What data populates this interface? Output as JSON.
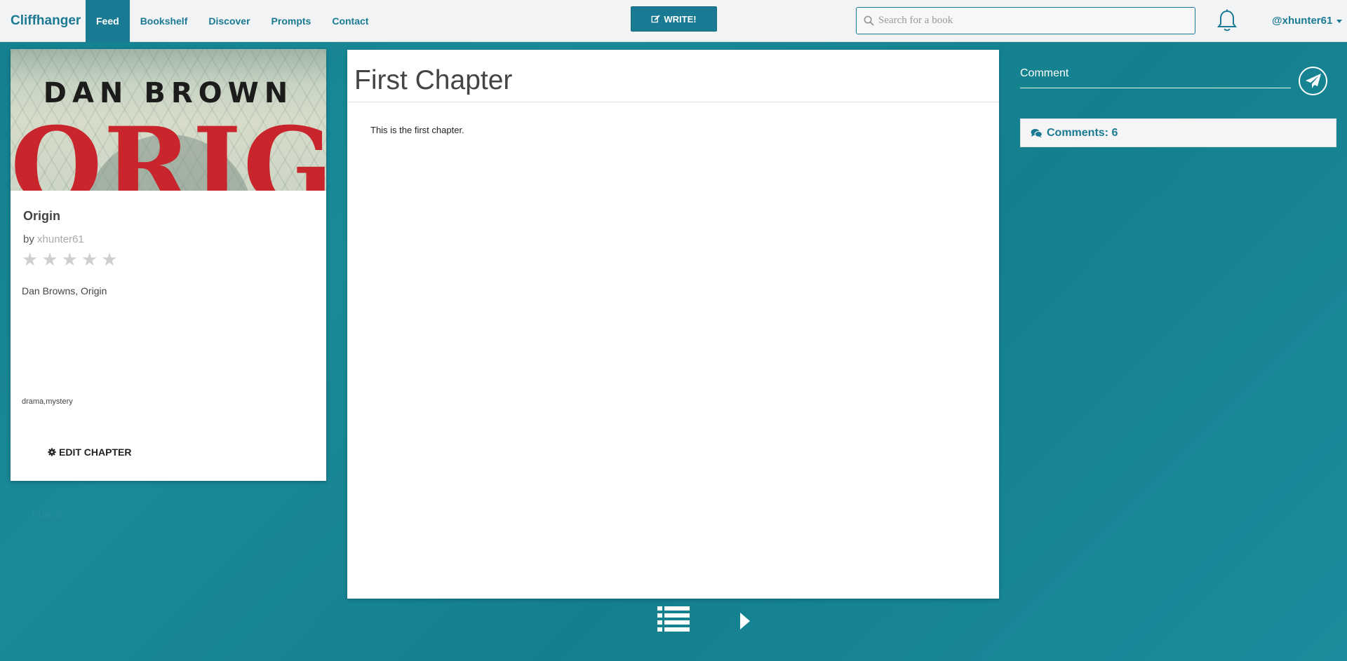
{
  "navbar": {
    "brand": "Cliffhanger",
    "items": [
      {
        "label": "Feed",
        "active": true
      },
      {
        "label": "Bookshelf",
        "active": false
      },
      {
        "label": "Discover",
        "active": false
      },
      {
        "label": "Prompts",
        "active": false
      },
      {
        "label": "Contact",
        "active": false
      }
    ],
    "write_label": "WRITE!",
    "search_placeholder": "Search for a book",
    "user": "@xhunter61"
  },
  "book": {
    "cover_author": "DAN BROWN",
    "cover_title": "ORIGIN",
    "title": "Origin",
    "by_prefix": "by",
    "author": "xhunter61",
    "rating": 0,
    "rating_max": 5,
    "description": "Dan Browns, Origin",
    "tags": "drama,mystery",
    "edit_label": "EDIT CHAPTER",
    "visibility": "PUBLIC"
  },
  "chapter": {
    "title": "First Chapter",
    "body": "This is the first chapter."
  },
  "comments": {
    "placeholder": "Comment",
    "count_label": "Comments: 6"
  },
  "colors": {
    "accent": "#1b7a93",
    "background": "#13808f",
    "cover_red": "#c8262c"
  },
  "icons": {
    "write": "edit-icon",
    "search": "search-icon",
    "notifications": "bell-icon",
    "edit": "gear-icon",
    "list": "list-icon",
    "next": "play-icon",
    "send": "paper-plane-icon",
    "comments": "comments-icon"
  }
}
